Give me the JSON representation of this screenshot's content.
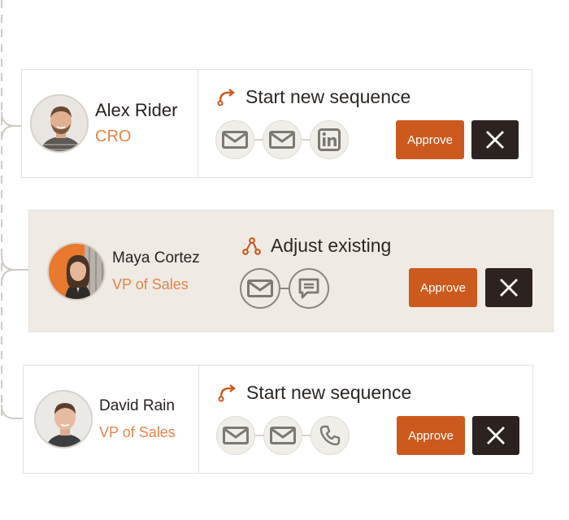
{
  "colors": {
    "accent": "#cc5a1e",
    "role_text": "#e3834a",
    "reject_bg": "#2c2220",
    "active_card_bg": "#efebe4"
  },
  "recommendations": [
    {
      "person": {
        "name": "Alex Rider",
        "role": "CRO"
      },
      "action": {
        "icon": "route-icon",
        "title": "Start new sequence"
      },
      "steps": [
        "email-icon",
        "email-icon",
        "linkedin-icon"
      ],
      "approve_label": "Approve",
      "reject_icon": "close-icon"
    },
    {
      "person": {
        "name": "Maya Cortez",
        "role": "VP of Sales"
      },
      "action": {
        "icon": "adjust-route-icon",
        "title": "Adjust existing"
      },
      "steps": [
        "email-icon",
        "chat-icon"
      ],
      "approve_label": "Approve",
      "reject_icon": "close-icon",
      "highlighted": true
    },
    {
      "person": {
        "name": "David Rain",
        "role": "VP of Sales"
      },
      "action": {
        "icon": "route-icon",
        "title": "Start new sequence"
      },
      "steps": [
        "email-icon",
        "email-icon",
        "phone-icon"
      ],
      "approve_label": "Approve",
      "reject_icon": "close-icon"
    }
  ]
}
